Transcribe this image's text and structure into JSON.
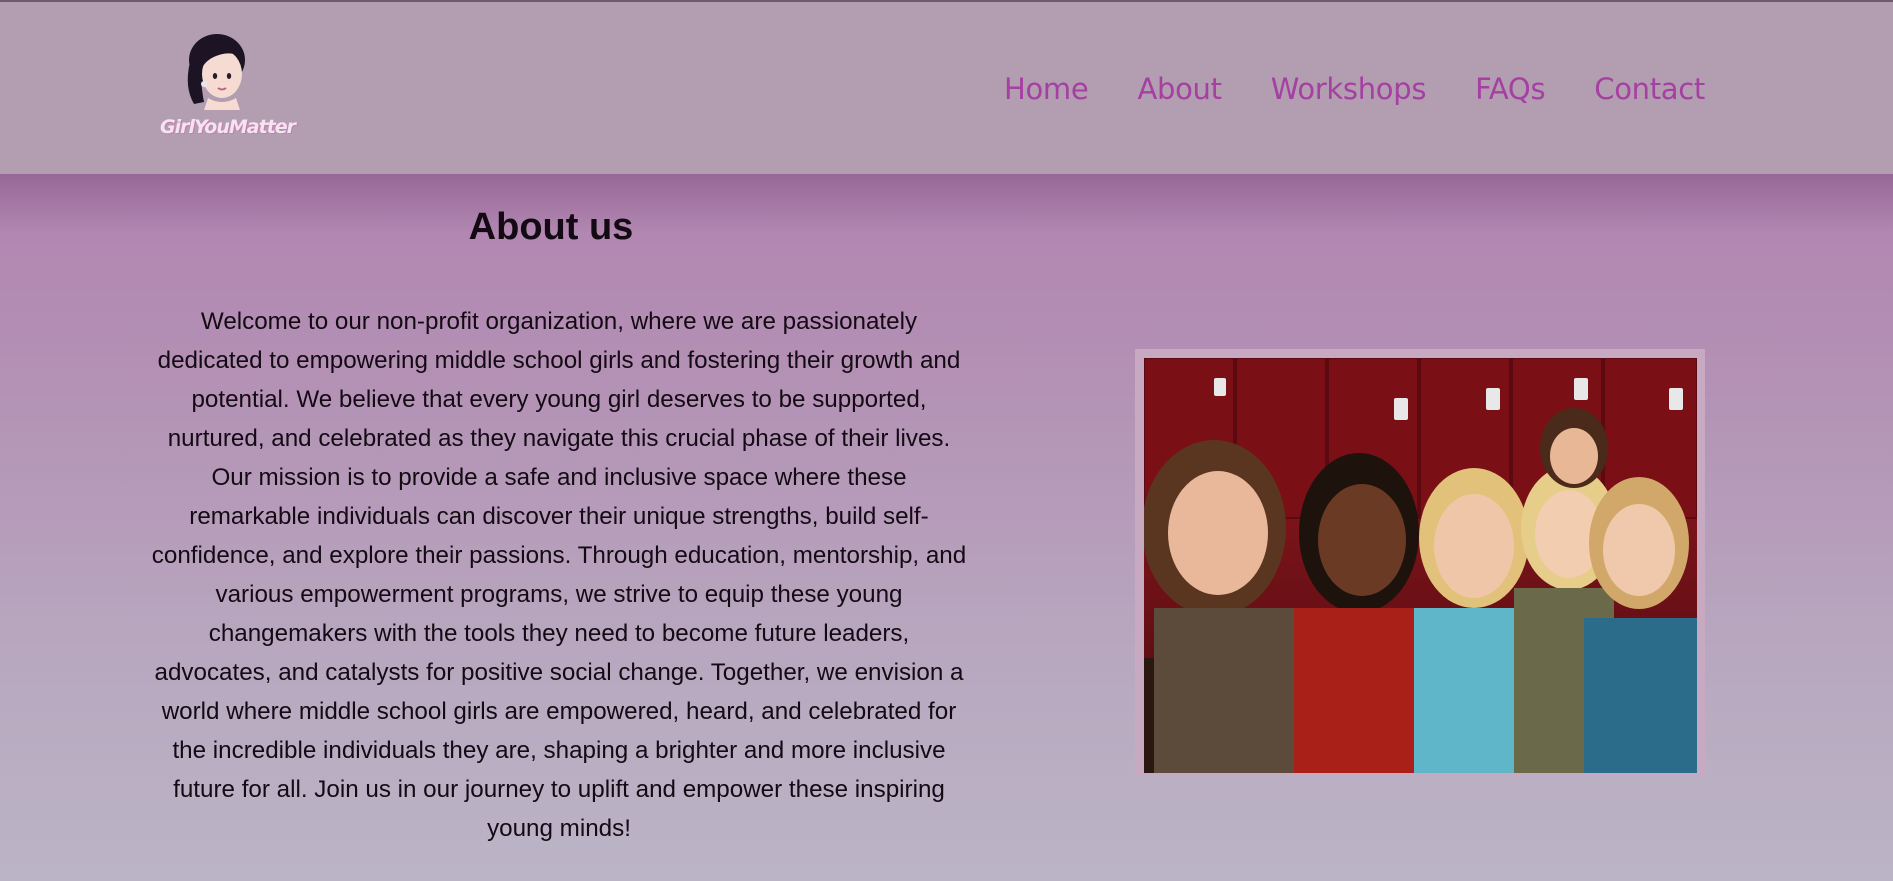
{
  "brand": {
    "logo_text": "GirlYouMatter"
  },
  "nav": {
    "items": [
      {
        "label": "Home"
      },
      {
        "label": "About"
      },
      {
        "label": "Workshops"
      },
      {
        "label": "FAQs"
      },
      {
        "label": "Contact"
      }
    ]
  },
  "about": {
    "title": "About us",
    "body": "Welcome to our non-profit organization, where we are passionately dedicated to empowering middle school girls and fostering their growth and potential. We believe that every young girl deserves to be supported, nurtured, and celebrated as they navigate this crucial phase of their lives. Our mission is to provide a safe and inclusive space where these remarkable individuals can discover their unique strengths, build self-confidence, and explore their passions. Through education, mentorship, and various empowerment programs, we strive to equip these young changemakers with the tools they need to become future leaders, advocates, and catalysts for positive social change. Together, we envision a world where middle school girls are empowered, heard, and celebrated for the incredible individuals they are, shaping a brighter and more inclusive future for all. Join us in our journey to uplift and empower these inspiring young minds!"
  },
  "colors": {
    "nav_link": "#a63fa2",
    "header_bg": "#b39db1",
    "text": "#140a14"
  }
}
